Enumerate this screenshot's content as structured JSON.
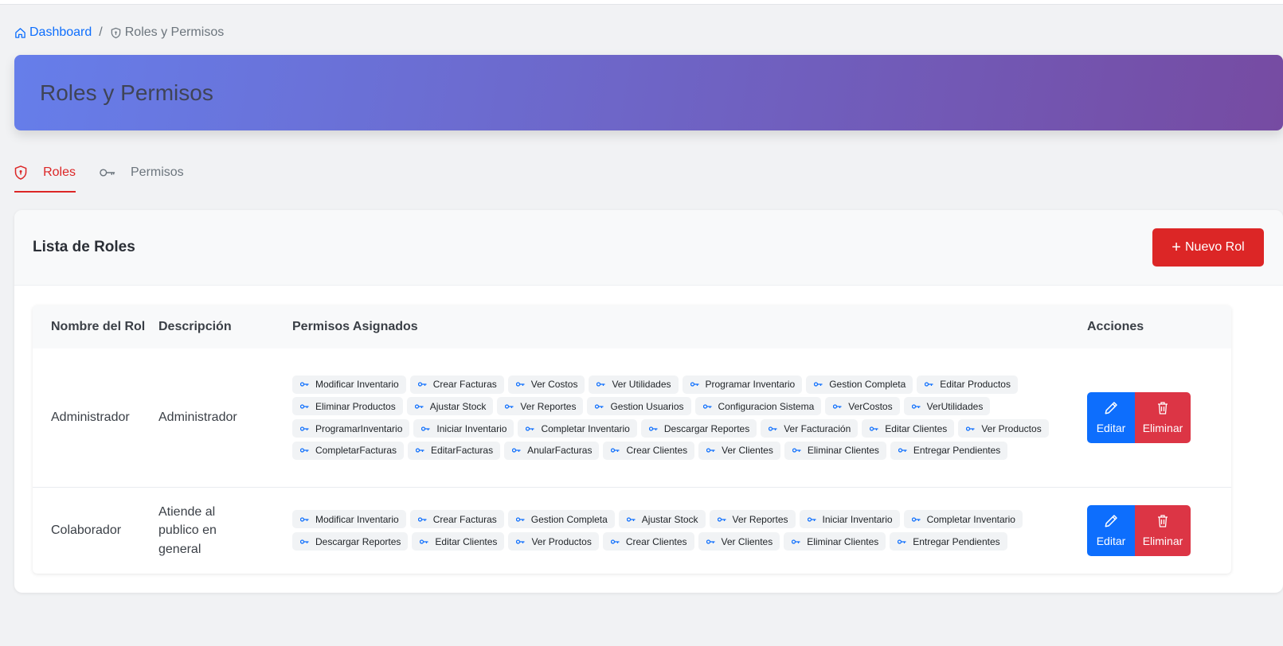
{
  "breadcrumb": {
    "home": "Dashboard",
    "separator": "/",
    "current": "Roles y Permisos"
  },
  "header": {
    "title": "Roles y Permisos"
  },
  "tabs": [
    {
      "label": "Roles",
      "icon": "shield-icon",
      "active": true
    },
    {
      "label": "Permisos",
      "icon": "key-icon",
      "active": false
    }
  ],
  "card": {
    "title": "Lista de Roles",
    "new_button": "Nuevo Rol"
  },
  "table": {
    "headers": [
      "Nombre del Rol",
      "Descripción",
      "Permisos Asignados",
      "Acciones"
    ],
    "rows": [
      {
        "name": "Administrador",
        "description": "Administrador",
        "permissions": [
          "Modificar Inventario",
          "Crear Facturas",
          "Ver Costos",
          "Ver Utilidades",
          "Programar Inventario",
          "Gestion Completa",
          "Editar Productos",
          "Eliminar Productos",
          "Ajustar Stock",
          "Ver Reportes",
          "Gestion Usuarios",
          "Configuracion Sistema",
          "VerCostos",
          "VerUtilidades",
          "ProgramarInventario",
          "Iniciar Inventario",
          "Completar Inventario",
          "Descargar Reportes",
          "Ver Facturación",
          "Editar Clientes",
          "Ver Productos",
          "CompletarFacturas",
          "EditarFacturas",
          "AnularFacturas",
          "Crear Clientes",
          "Ver Clientes",
          "Eliminar Clientes",
          "Entregar Pendientes"
        ],
        "edit_label": "Editar",
        "delete_label": "Eliminar"
      },
      {
        "name": "Colaborador",
        "description": "Atiende al publico en general",
        "permissions": [
          "Modificar Inventario",
          "Crear Facturas",
          "Gestion Completa",
          "Ajustar Stock",
          "Ver Reportes",
          "Iniciar Inventario",
          "Completar Inventario",
          "Descargar Reportes",
          "Editar Clientes",
          "Ver Productos",
          "Crear Clientes",
          "Ver Clientes",
          "Eliminar Clientes",
          "Entregar Pendientes"
        ],
        "edit_label": "Editar",
        "delete_label": "Eliminar"
      }
    ]
  },
  "colors": {
    "accent_red": "#dc2626",
    "primary_blue": "#0d6efd",
    "danger": "#dc3545",
    "gradient_start": "#667eea",
    "gradient_end": "#764ba2"
  }
}
